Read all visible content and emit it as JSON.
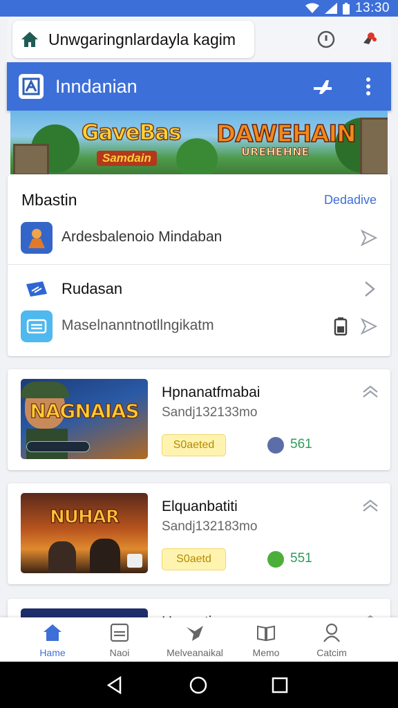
{
  "status_bar": {
    "time": "13:30"
  },
  "url_bar": {
    "url": "Unwgaringnlardayla kagim"
  },
  "app_bar": {
    "title": "Inndanian"
  },
  "banner": {
    "left_title": "GaveBas",
    "left_subtitle": "Samdain",
    "right_title": "DAWEHAIN",
    "right_subtitle": "UREHEHNE"
  },
  "menu": {
    "title": "Mbastin",
    "link": "Dedadive",
    "items": [
      {
        "label": "Ardesbalenoio Mindaban"
      },
      {
        "label": "Rudasan"
      },
      {
        "label": "Maselnanntnotllngikatm"
      }
    ]
  },
  "games": [
    {
      "thumb_title": "NAGNAIAS",
      "title": "Hpnanatfmabai",
      "subtitle": "Sandj132133mo",
      "badge": "S0aeted",
      "score": "561"
    },
    {
      "thumb_title": "NUHAR",
      "title": "Elquanbatiti",
      "subtitle": "Sandj132183mo",
      "badge": "S0aetd",
      "score": "551"
    },
    {
      "title": "Hnuantia"
    }
  ],
  "bottom_nav": [
    {
      "label": "Hame"
    },
    {
      "label": "Naoi"
    },
    {
      "label": "Melveanaikal"
    },
    {
      "label": "Memo"
    },
    {
      "label": "Catcim"
    }
  ],
  "colors": {
    "primary": "#3d6fd8",
    "score": "#2f9b5a",
    "badge": "#fff3b0"
  }
}
